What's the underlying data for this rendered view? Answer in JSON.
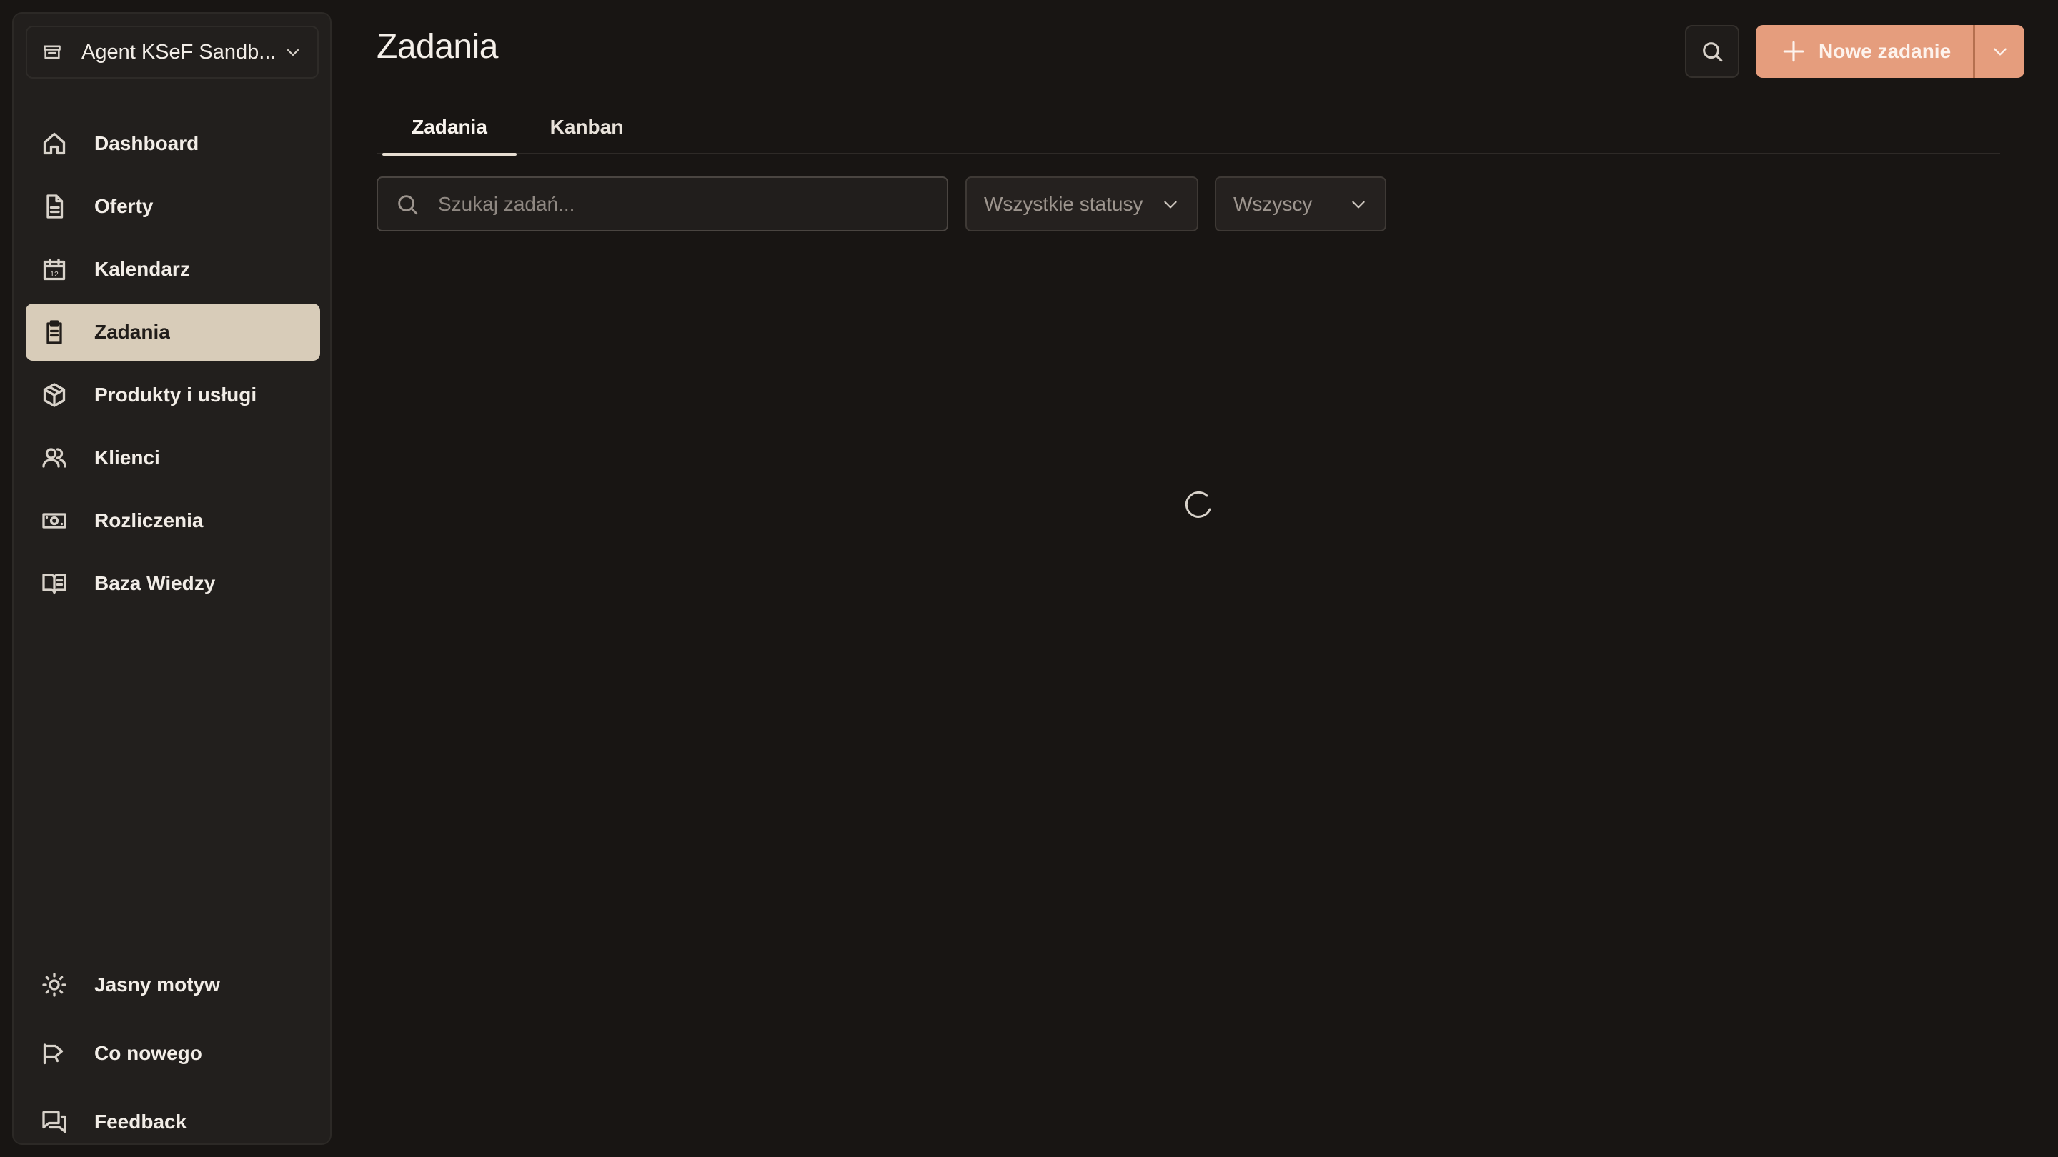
{
  "sidebar": {
    "workspace": {
      "name": "Agent KSeF Sandb..."
    },
    "nav": [
      {
        "label": "Dashboard",
        "icon": "home-icon"
      },
      {
        "label": "Oferty",
        "icon": "document-icon"
      },
      {
        "label": "Kalendarz",
        "icon": "calendar-icon"
      },
      {
        "label": "Zadania",
        "icon": "clipboard-icon",
        "active": true
      },
      {
        "label": "Produkty i usługi",
        "icon": "box-icon"
      },
      {
        "label": "Klienci",
        "icon": "users-icon"
      },
      {
        "label": "Rozliczenia",
        "icon": "banknote-icon"
      },
      {
        "label": "Baza Wiedzy",
        "icon": "book-icon"
      }
    ],
    "bottom": [
      {
        "label": "Jasny motyw",
        "icon": "sun-icon"
      },
      {
        "label": "Co nowego",
        "icon": "megaphone-icon"
      },
      {
        "label": "Feedback",
        "icon": "chat-icon"
      }
    ]
  },
  "header": {
    "title": "Zadania",
    "new_button_label": "Nowe zadanie"
  },
  "tabs": [
    {
      "label": "Zadania",
      "active": true
    },
    {
      "label": "Kanban"
    }
  ],
  "filters": {
    "search_placeholder": "Szukaj zadań...",
    "status_select": "Wszystkie statusy",
    "assignee_select": "Wszyscy"
  },
  "colors": {
    "background": "#181513",
    "sidebar": "#221f1d",
    "active_nav": "#d8ccb9",
    "accent": "#e59d7d"
  }
}
